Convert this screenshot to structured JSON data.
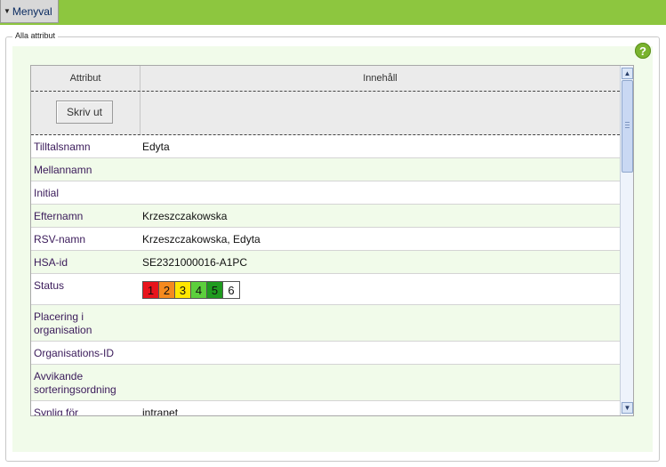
{
  "topbar": {
    "menu_label": "Menyval"
  },
  "section": {
    "legend": "Alla attribut"
  },
  "help": {
    "label": "?"
  },
  "table": {
    "headers": {
      "attribute": "Attribut",
      "content": "Innehåll"
    },
    "print_button": "Skriv ut",
    "rows": [
      {
        "label": "Tilltalsnamn",
        "value": "Edyta"
      },
      {
        "label": "Mellannamn",
        "value": ""
      },
      {
        "label": "Initial",
        "value": ""
      },
      {
        "label": "Efternamn",
        "value": "Krzeszczakowska"
      },
      {
        "label": "RSV-namn",
        "value": "Krzeszczakowska, Edyta"
      },
      {
        "label": "HSA-id",
        "value": "SE2321000016-A1PC"
      },
      {
        "label": "Status",
        "value": ""
      },
      {
        "label": "Placering i organisation",
        "value": ""
      },
      {
        "label": "Organisations-ID",
        "value": ""
      },
      {
        "label": "Avvikande sorteringsordning",
        "value": ""
      },
      {
        "label": "Synlig för",
        "value": "intranet"
      }
    ],
    "status_levels": [
      {
        "label": "1",
        "color": "#e8141c"
      },
      {
        "label": "2",
        "color": "#f58a1f"
      },
      {
        "label": "3",
        "color": "#ffe600"
      },
      {
        "label": "4",
        "color": "#5ccf3c"
      },
      {
        "label": "5",
        "color": "#1f9b1f"
      },
      {
        "label": "6",
        "color": "#ffffff"
      }
    ]
  }
}
